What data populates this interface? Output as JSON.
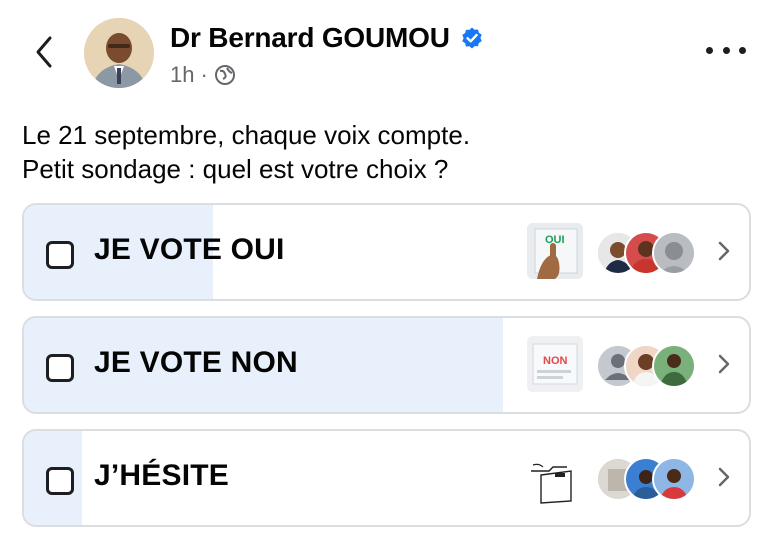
{
  "header": {
    "author": "Dr Bernard GOUMOU",
    "time": "1h",
    "separator": "·",
    "icons": [
      "back-chevron-icon",
      "verified-badge-icon",
      "public-globe-icon",
      "more-options-icon"
    ],
    "colors": {
      "verified": "#1877f2",
      "meta": "#65676b"
    }
  },
  "post": {
    "line1": "Le 21 septembre, chaque voix compte.",
    "line2": "Petit sondage : quel est votre choix ?"
  },
  "poll": {
    "options": [
      {
        "label": "JE VOTE OUI",
        "vote_share": 0.26,
        "thumb_text": "OUI"
      },
      {
        "label": "JE VOTE NON",
        "vote_share": 0.66,
        "thumb_text": "NON"
      },
      {
        "label": "J’HÉSITE",
        "vote_share": 0.08
      }
    ],
    "colors": {
      "fill": "#e7f0fb",
      "border": "#dadde1"
    }
  }
}
